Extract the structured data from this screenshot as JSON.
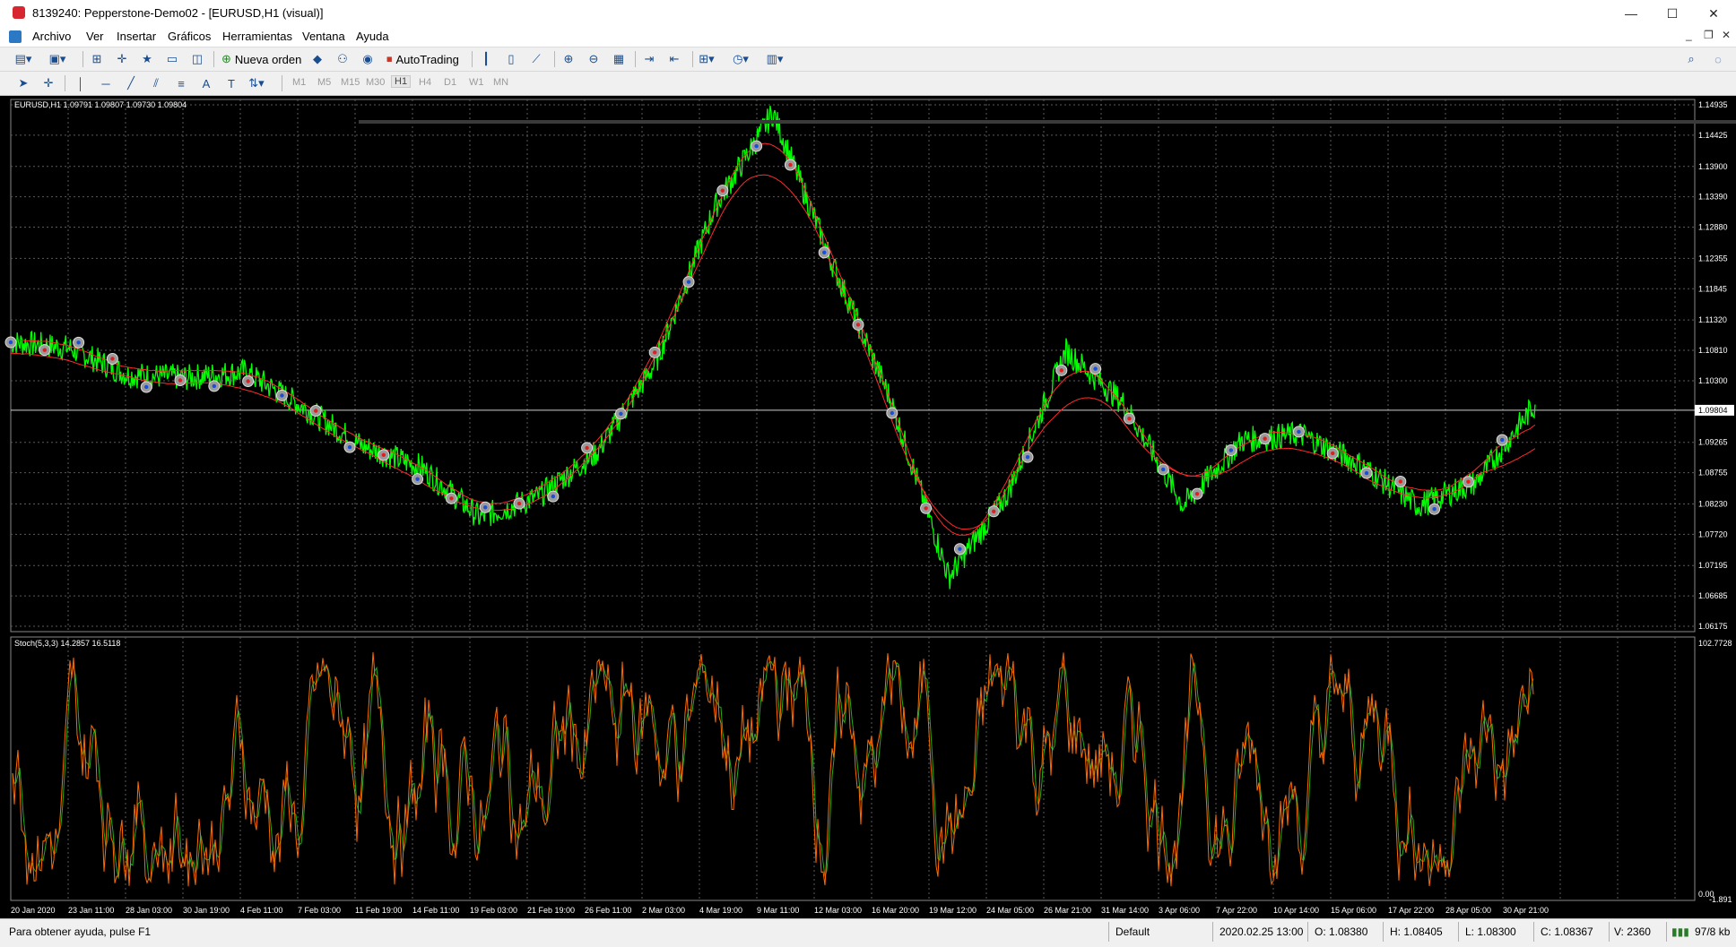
{
  "window": {
    "title": "8139240: Pepperstone-Demo02 - [EURUSD,H1 (visual)]",
    "controls": {
      "minimize": "—",
      "maximize": "☐",
      "close": "✕"
    }
  },
  "menu": {
    "items": [
      "Archivo",
      "Ver",
      "Insertar",
      "Gráficos",
      "Herramientas",
      "Ventana",
      "Ayuda"
    ],
    "mdi_controls": {
      "minimize": "_",
      "restore": "❐",
      "close": "✕"
    }
  },
  "toolbar": {
    "new_order_label": "Nueva orden",
    "autotrading_label": "AutoTrading",
    "timeframes": [
      "M1",
      "M5",
      "M15",
      "M30",
      "H1",
      "H4",
      "D1",
      "W1",
      "MN"
    ],
    "active_timeframe": "H1",
    "text_tool_label": "A"
  },
  "chart": {
    "header": "EURUSD,H1  1.09791 1.09807 1.09730 1.09804",
    "indicator_header": "Stoch(5,3,3) 14.2857 16.5118",
    "price_labels": [
      "1.14935",
      "1.14425",
      "1.13900",
      "1.13390",
      "1.12880",
      "1.12355",
      "1.11845",
      "1.11320",
      "1.10810",
      "1.10300",
      "1.09804",
      "1.09265",
      "1.08755",
      "1.08230",
      "1.07720",
      "1.07195",
      "1.06685",
      "1.06175"
    ],
    "current_price": "1.09804",
    "stoch_labels": [
      "102.7728",
      "0.00",
      "-1.891"
    ],
    "time_labels": [
      "20 Jan 2020",
      "23 Jan 11:00",
      "28 Jan 03:00",
      "30 Jan 19:00",
      "4 Feb 11:00",
      "7 Feb 03:00",
      "11 Feb 19:00",
      "14 Feb 11:00",
      "19 Feb 03:00",
      "21 Feb 19:00",
      "26 Feb 11:00",
      "2 Mar 03:00",
      "4 Mar 19:00",
      "9 Mar 11:00",
      "12 Mar 03:00",
      "16 Mar 20:00",
      "19 Mar 12:00",
      "24 Mar 05:00",
      "26 Mar 21:00",
      "31 Mar 14:00",
      "3 Apr 06:00",
      "7 Apr 22:00",
      "10 Apr 14:00",
      "15 Apr 06:00",
      "17 Apr 22:00",
      "28 Apr 05:00",
      "30 Apr 21:00"
    ],
    "colors": {
      "background": "#000000",
      "grid": "#5a5a5a",
      "price": "#00ff00",
      "bands": "#ff2a2a",
      "stoch_main": "#ff6a00",
      "stoch_signal": "#22aa22",
      "text": "#ffffff"
    }
  },
  "chart_data": {
    "type": "line",
    "title": "EURUSD,H1",
    "ylim": [
      1.06175,
      1.14935
    ],
    "x": [
      "20 Jan 2020",
      "23 Jan 11:00",
      "28 Jan 03:00",
      "30 Jan 19:00",
      "4 Feb 11:00",
      "7 Feb 03:00",
      "11 Feb 19:00",
      "14 Feb 11:00",
      "19 Feb 03:00",
      "21 Feb 19:00",
      "26 Feb 11:00",
      "2 Mar 03:00",
      "4 Mar 19:00",
      "9 Mar 11:00",
      "12 Mar 03:00",
      "16 Mar 20:00",
      "19 Mar 12:00",
      "24 Mar 05:00",
      "26 Mar 21:00",
      "31 Mar 14:00",
      "3 Apr 06:00",
      "7 Apr 22:00",
      "10 Apr 14:00",
      "15 Apr 06:00",
      "17 Apr 22:00",
      "28 Apr 05:00",
      "30 Apr 21:00"
    ],
    "series": [
      {
        "values": [
          1.1095,
          1.1085,
          1.104,
          1.1035,
          1.1045,
          1.0985,
          1.092,
          1.0885,
          1.08,
          1.0835,
          1.091,
          1.106,
          1.132,
          1.148,
          1.123,
          1.1,
          1.07,
          1.084,
          1.108,
          1.099,
          1.082,
          1.093,
          1.094,
          1.089,
          1.082,
          1.086,
          1.099
        ]
      }
    ],
    "subchart": {
      "type": "line",
      "title": "Stoch(5,3,3)",
      "ylim": [
        -1.891,
        102.7728
      ],
      "last_values": {
        "main": 14.2857,
        "signal": 16.5118
      }
    }
  },
  "status": {
    "help": "Para obtener ayuda, pulse F1",
    "profile": "Default",
    "datetime": "2020.02.25 13:00",
    "open": "O: 1.08380",
    "high": "H: 1.08405",
    "low": "L: 1.08300",
    "close": "C: 1.08367",
    "volume": "V: 2360",
    "traffic": "97/8 kb"
  }
}
